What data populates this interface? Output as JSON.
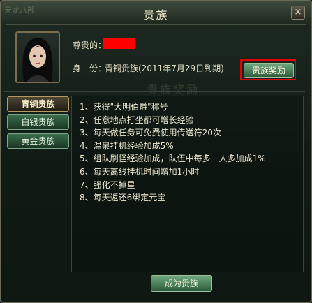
{
  "window": {
    "title": "贵族",
    "corner_logo": "天龙八部",
    "close_label": "×"
  },
  "profile": {
    "honor_label": "尊贵的：",
    "identity_label": "身　份：",
    "identity_value": "青铜贵族(2011年7月29日到期)",
    "reward_button": "贵族奖励"
  },
  "watermark": "贵族奖励",
  "tabs": [
    {
      "label": "青铜贵族",
      "active": true
    },
    {
      "label": "白银贵族",
      "active": false
    },
    {
      "label": "黄金贵族",
      "active": false
    }
  ],
  "benefits": [
    "1、获得\"大明伯爵\"称号",
    "2、任意地点打坐都可增长经验",
    "3、每天做任务可免费使用传送符20次",
    "4、温泉挂机经验加成5%",
    "5、组队刷怪经验加成，队伍中每多一人多加成1%",
    "6、每天离线挂机时间增加1小时",
    "7、强化不掉星",
    "8、每天返还6绑定元宝"
  ],
  "become_button": "成为贵族",
  "colors": {
    "highlight": "#e60000",
    "name_redaction": "#ff0000",
    "button_green": "#3f7a52",
    "text": "#ece6cf"
  }
}
